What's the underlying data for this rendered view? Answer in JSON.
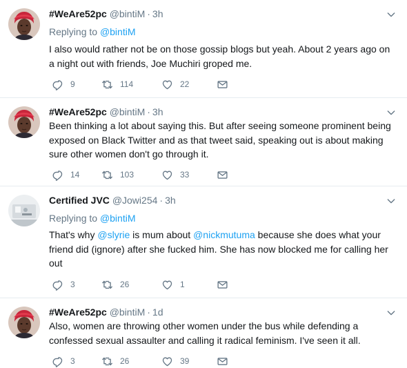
{
  "tweets": [
    {
      "name": "#WeAre52pc",
      "handle": "@bintiM",
      "dot": "·",
      "time": "3h",
      "avatar": "woman-red-headwrap",
      "reply_prefix": "Replying to",
      "reply_to": "@bintiM",
      "text": "I also would rather not be on those gossip blogs but yeah. About 2 years ago on a night out with friends, Joe Muchiri groped me.",
      "replies": "9",
      "retweets": "114",
      "likes": "22"
    },
    {
      "name": "#WeAre52pc",
      "handle": "@bintiM",
      "dot": "·",
      "time": "3h",
      "avatar": "woman-red-headwrap",
      "text": "Been thinking a lot about saying this. But after seeing someone prominent being exposed on Black Twitter and as that tweet said, speaking out is about making sure other women don't go through it.",
      "replies": "14",
      "retweets": "103",
      "likes": "33"
    },
    {
      "name": "Certified JVC",
      "handle": "@Jowi254",
      "dot": "·",
      "time": "3h",
      "avatar": "grey-photo",
      "reply_prefix": "Replying to",
      "reply_to": "@bintiM",
      "text_parts": [
        "That's why ",
        "@slyrie",
        " is mum about ",
        "@nickmutuma",
        " because she does what your friend did (ignore) after she fucked him. She has now blocked me for calling her out"
      ],
      "replies": "3",
      "retweets": "26",
      "likes": "1"
    },
    {
      "name": "#WeAre52pc",
      "handle": "@bintiM",
      "dot": "·",
      "time": "1d",
      "avatar": "woman-red-headwrap",
      "text": "Also, women are throwing other women under the bus while defending a confessed sexual assaulter and calling it radical feminism. I've seen it all.",
      "replies": "3",
      "retweets": "26",
      "likes": "39"
    }
  ],
  "colors": {
    "text": "#14171a",
    "secondary": "#657786",
    "link": "#1da1f2",
    "divider": "#e6ecf0"
  },
  "icons": [
    "reply-icon",
    "retweet-icon",
    "like-icon",
    "direct-message-icon",
    "chevron-down-icon"
  ]
}
